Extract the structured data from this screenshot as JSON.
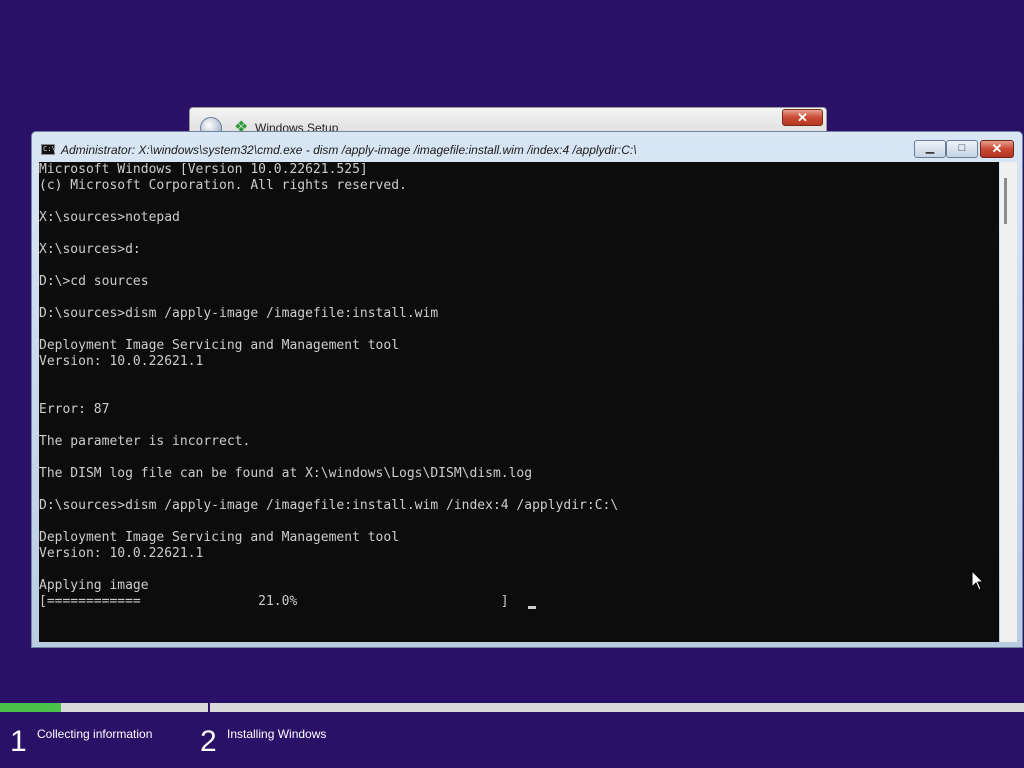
{
  "setup_window": {
    "title": "Windows Setup",
    "close_glyph": "✕"
  },
  "cmd_window": {
    "title": "Administrator: X:\\windows\\system32\\cmd.exe - dism  /apply-image /imagefile:install.wim /index:4 /applydir:C:\\",
    "icon": "cmd-icon",
    "minimize_glyph": "▁",
    "maximize_glyph": "□",
    "close_glyph": "✕",
    "console_lines": [
      "Microsoft Windows [Version 10.0.22621.525]",
      "(c) Microsoft Corporation. All rights reserved.",
      "",
      "X:\\sources>notepad",
      "",
      "X:\\sources>d:",
      "",
      "D:\\>cd sources",
      "",
      "D:\\sources>dism /apply-image /imagefile:install.wim",
      "",
      "Deployment Image Servicing and Management tool",
      "Version: 10.0.22621.1",
      "",
      "",
      "Error: 87",
      "",
      "The parameter is incorrect.",
      "",
      "The DISM log file can be found at X:\\windows\\Logs\\DISM\\dism.log",
      "",
      "D:\\sources>dism /apply-image /imagefile:install.wim /index:4 /applydir:C:\\",
      "",
      "Deployment Image Servicing and Management tool",
      "Version: 10.0.22621.1",
      "",
      "Applying image",
      "[============               21.0%                          ] "
    ]
  },
  "setup_progress": {
    "percent": 6,
    "steps": [
      {
        "number": "1",
        "label": "Collecting information"
      },
      {
        "number": "2",
        "label": "Installing Windows"
      }
    ]
  },
  "colors": {
    "desktop_bg": "#2a1066",
    "console_bg": "#0c0c0c",
    "console_fg": "#cccccc",
    "progress_green": "#4cc24a"
  }
}
